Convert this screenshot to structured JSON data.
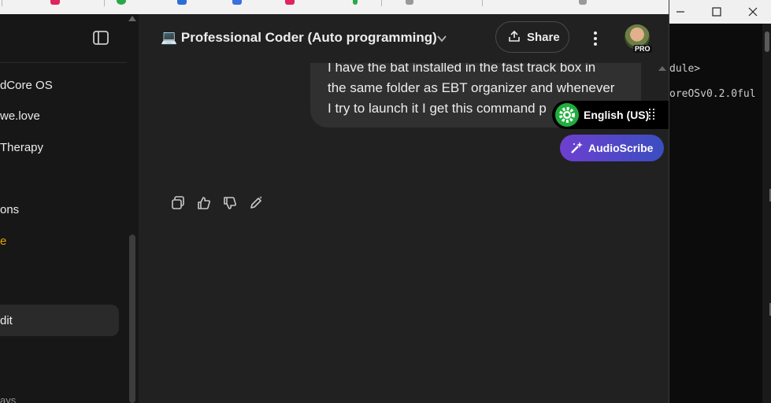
{
  "sidebar": {
    "items": [
      {
        "label": "dCore OS"
      },
      {
        "label": "we.love"
      },
      {
        "label": "Therapy"
      },
      {
        "label": "ons"
      },
      {
        "label": "e"
      },
      {
        "label": "dit"
      },
      {
        "label": "ays"
      }
    ]
  },
  "header": {
    "title": "💻 Professional Coder (Auto programming)",
    "share_label": "Share",
    "pro_badge": "PRO"
  },
  "message": {
    "lines": [
      "I have the bat installed in the fast track box in",
      "the same folder as EBT organizer and whenever",
      "I try to launch it I get this command p"
    ]
  },
  "language_widget": {
    "label": "English (US)"
  },
  "audioscribe": {
    "label": "AudioScribe"
  },
  "terminal": {
    "lines": [
      "dule>",
      "oreOSv0.2.0ful"
    ]
  },
  "colors": {
    "background": "#212121",
    "sidebar": "#171717",
    "bubble": "#303030",
    "lang_gear": "#1fae3c",
    "audioscribe_start": "#6d3fd0",
    "audioscribe_end": "#3a4ec0"
  }
}
